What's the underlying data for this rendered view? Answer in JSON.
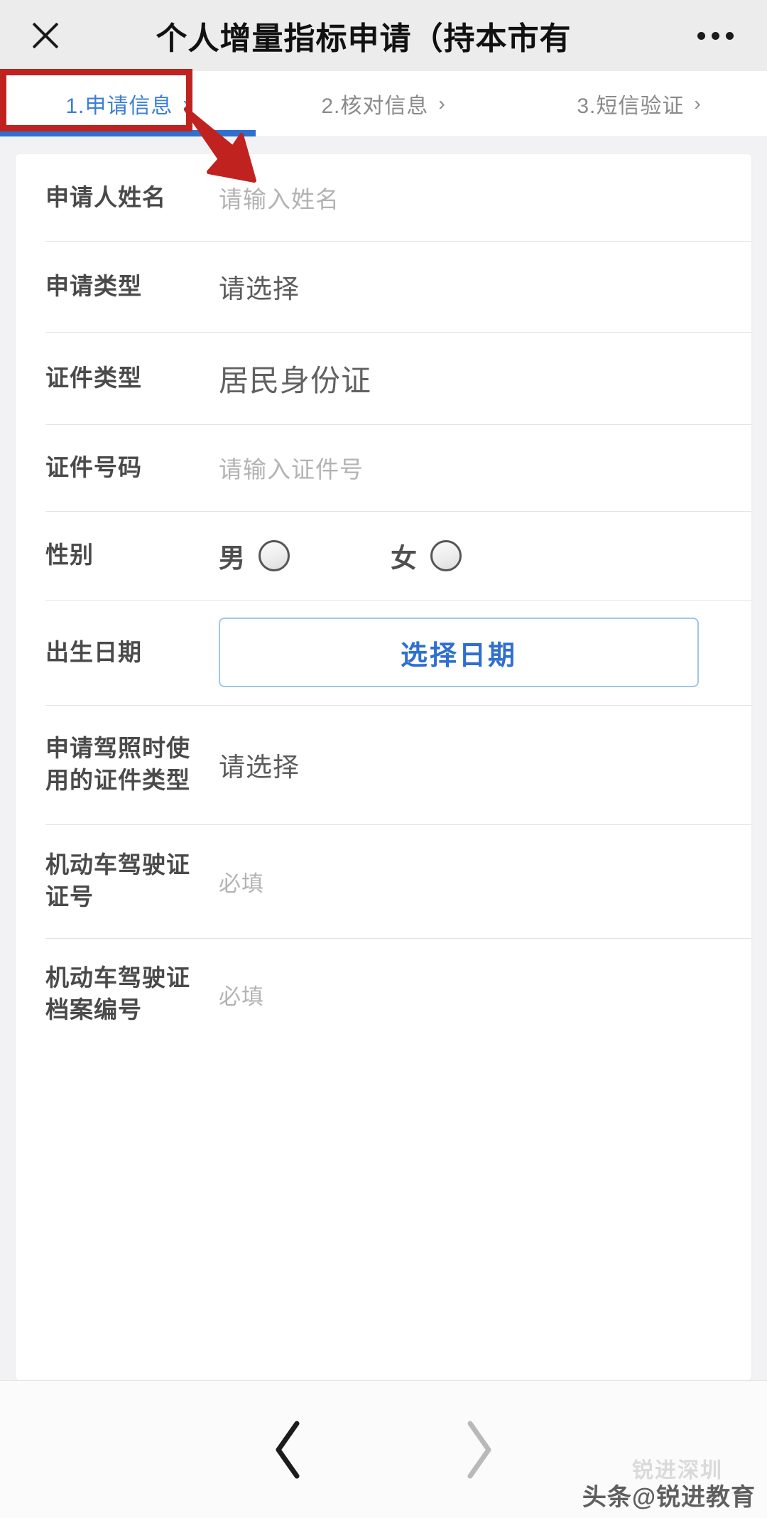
{
  "header": {
    "close_icon": "close-icon",
    "title": "个人增量指标申请（持本市有",
    "more_icon": "more-options-icon"
  },
  "steps": [
    {
      "label": "1.申请信息",
      "chevron": "›",
      "active": true
    },
    {
      "label": "2.核对信息",
      "chevron": "›",
      "active": false
    },
    {
      "label": "3.短信验证",
      "chevron": "›",
      "active": false
    }
  ],
  "form": {
    "applicant_name": {
      "label": "申请人姓名",
      "placeholder": "请输入姓名",
      "value": ""
    },
    "apply_type": {
      "label": "申请类型",
      "value": "请选择"
    },
    "id_type": {
      "label": "证件类型",
      "value": "居民身份证"
    },
    "id_number": {
      "label": "证件号码",
      "placeholder": "请输入证件号",
      "value": ""
    },
    "gender": {
      "label": "性别",
      "options": [
        {
          "text": "男",
          "selected": false
        },
        {
          "text": "女",
          "selected": false
        }
      ]
    },
    "birth_date": {
      "label": "出生日期",
      "button_label": "选择日期"
    },
    "license_id_type": {
      "label": "申请驾照时使用的证件类型",
      "value": "请选择"
    },
    "license_number": {
      "label": "机动车驾驶证证号",
      "placeholder": "必填",
      "value": ""
    },
    "license_file_number": {
      "label": "机动车驾驶证档案编号",
      "placeholder": "必填",
      "value": ""
    }
  },
  "bottom_nav": {
    "back_icon": "chevron-left-icon",
    "forward_icon": "chevron-right-icon"
  },
  "watermark": {
    "text": "头条@锐进教育",
    "ghost_text": "锐进深圳"
  },
  "colors": {
    "accent_blue": "#2f6fd0",
    "annotation_red": "#c0231f",
    "header_bg": "#ececec",
    "page_bg": "#f2f2f4",
    "label_gray": "#4a4a4a",
    "placeholder_gray": "#b3b3b3"
  }
}
